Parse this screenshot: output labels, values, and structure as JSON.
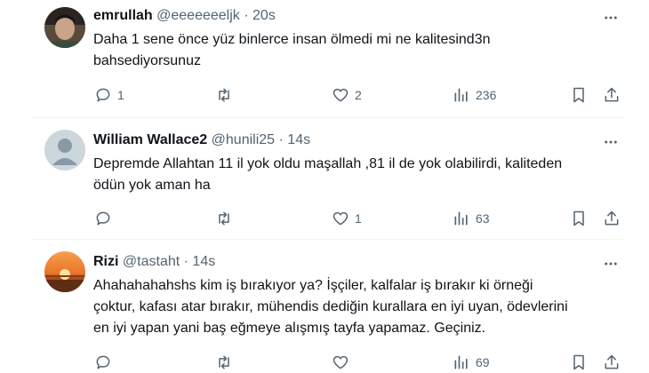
{
  "tweets": [
    {
      "name": "emrullah",
      "handle": "@eeeeeeeljk",
      "separator": "·",
      "time": "20s",
      "text_lines": [
        "Daha 1 sene önce yüz binlerce insan ölmedi mi ne kalitesind3n",
        "bahsediyorsunuz"
      ],
      "replies": "1",
      "retweets": "",
      "likes": "2",
      "views": "236"
    },
    {
      "name": "William Wallace2",
      "handle": "@hunili25",
      "separator": "·",
      "time": "14s",
      "text_lines": [
        "Depremde Allahtan 11 il yok oldu maşallah ,81 il de yok olabilirdi, kaliteden",
        "ödün  yok aman ha"
      ],
      "replies": "",
      "retweets": "",
      "likes": "1",
      "views": "63"
    },
    {
      "name": "Rizi",
      "handle": "@tastaht",
      "separator": "·",
      "time": "14s",
      "text_lines": [
        "Ahahahahahshs kim iş bırakıyor ya? İşçiler, kalfalar iş bırakır ki örneği",
        "çoktur, kafası atar bırakır, mühendis dediğin kurallara en iyi uyan, ödevlerini",
        "en iyi yapan yani baş eğmeye alışmış tayfa yapamaz. Geçiniz."
      ],
      "replies": "",
      "retweets": "",
      "likes": "",
      "views": "69"
    }
  ],
  "icons": {
    "more": "more-horizontal-icon",
    "reply": "reply-icon",
    "retweet": "retweet-icon",
    "like": "heart-icon",
    "views": "views-icon",
    "bookmark": "bookmark-icon",
    "share": "share-icon"
  },
  "colors": {
    "text": "#0f1419",
    "secondary": "#536471",
    "divider": "#eff3f4"
  }
}
